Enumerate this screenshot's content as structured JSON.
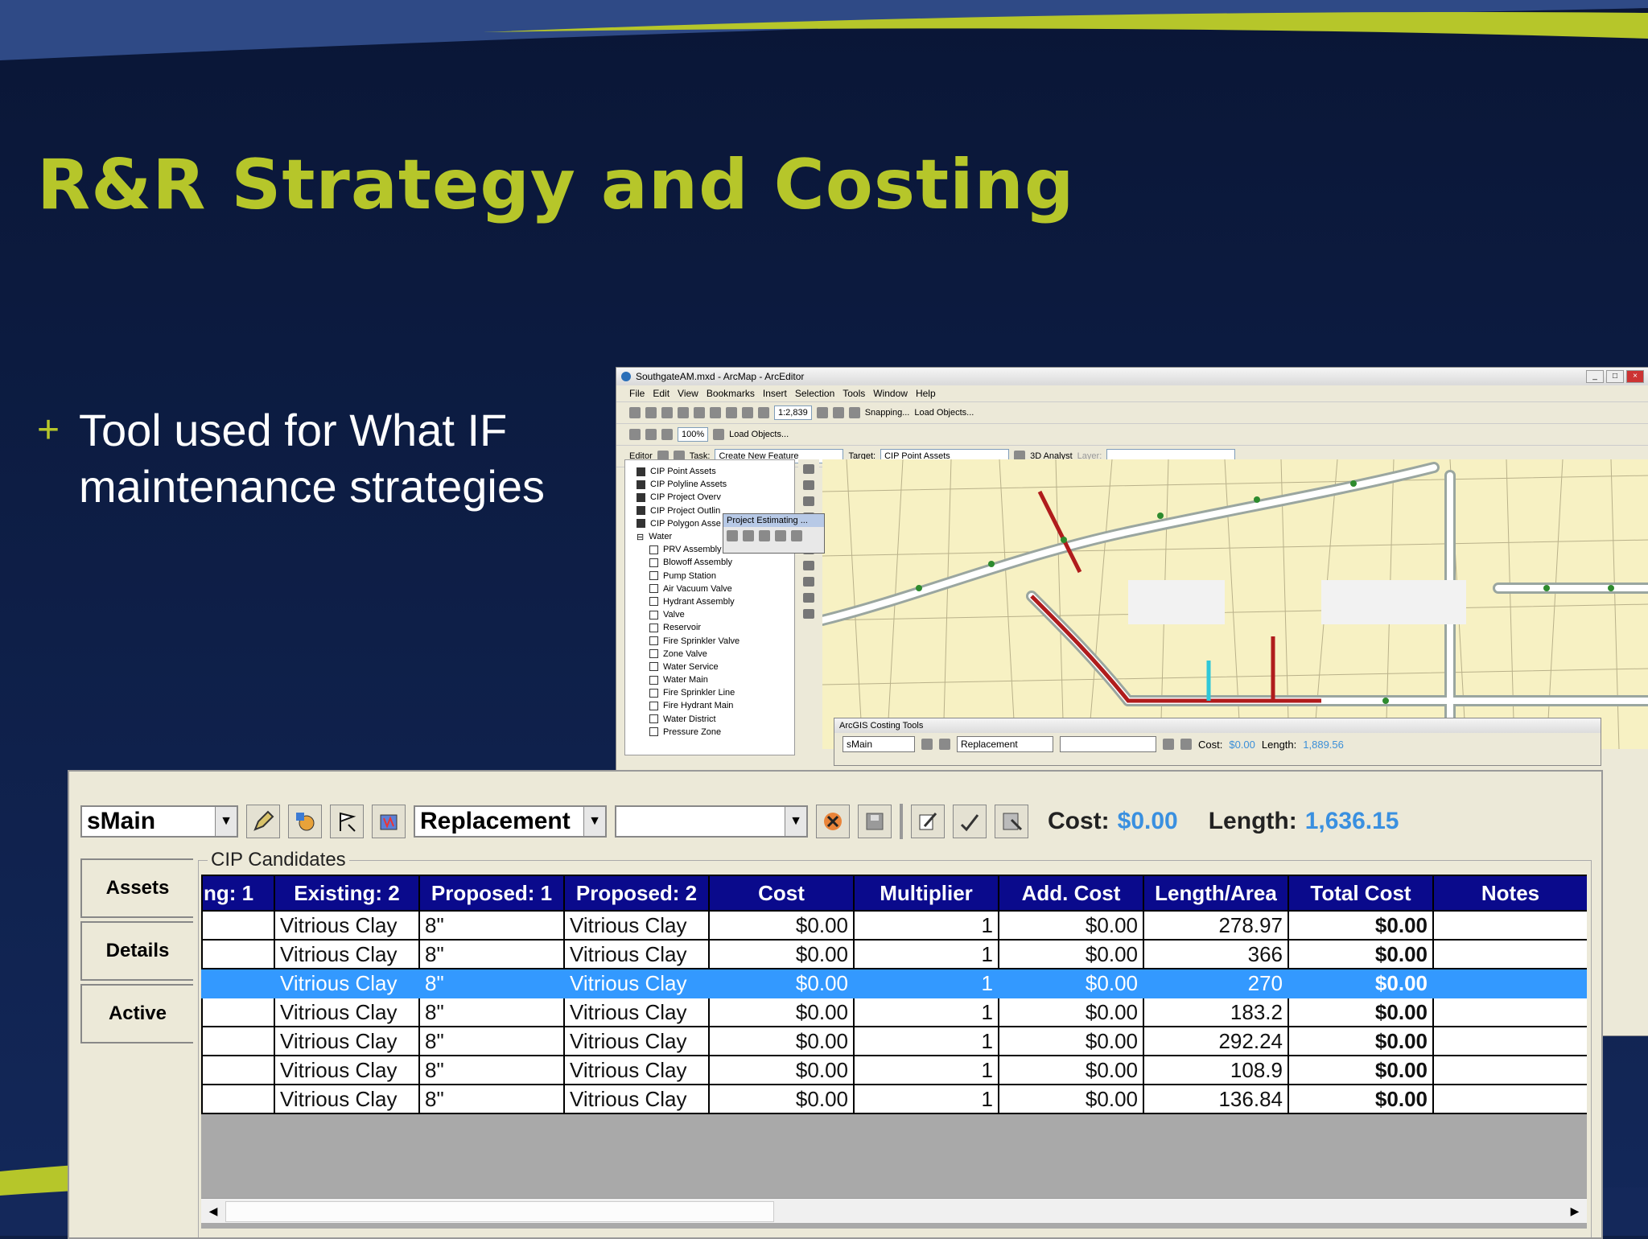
{
  "slide": {
    "title": "R&R Strategy and Costing",
    "bullet_marker": "+",
    "bullet_text": "Tool used for What IF maintenance strategies"
  },
  "arcmap": {
    "window_title": "SouthgateAM.mxd - ArcMap - ArcEditor",
    "menu": [
      "File",
      "Edit",
      "View",
      "Bookmarks",
      "Insert",
      "Selection",
      "Tools",
      "Window",
      "Help"
    ],
    "scale": "1:2,839",
    "zoom_percent": "100%",
    "snapping_label": "Snapping...",
    "load_objects_label": "Load Objects...",
    "load_objects_label2": "Load Objects...",
    "editor_label": "Editor",
    "task_label": "Task:",
    "task_value": "Create New Feature",
    "target_label": "Target:",
    "target_value": "CIP Point Assets",
    "analyst_label": "3D Analyst",
    "layer_label": "Layer:",
    "toc_items": [
      {
        "label": "CIP Point Assets",
        "checked": true
      },
      {
        "label": "CIP Polyline Assets",
        "checked": true
      },
      {
        "label": "CIP Project Overv",
        "checked": true
      },
      {
        "label": "CIP Project Outlin",
        "checked": true
      },
      {
        "label": "CIP Polygon Asse",
        "checked": true
      }
    ],
    "toc_group": "Water",
    "toc_subitems": [
      "PRV Assembly",
      "Blowoff Assembly",
      "Pump Station",
      "Air Vacuum Valve",
      "Hydrant Assembly",
      "Valve",
      "Reservoir",
      "Fire Sprinkler Valve",
      "Zone Valve",
      "Water Service",
      "Water Main",
      "Fire Sprinkler Line",
      "Fire Hydrant Main",
      "Water District",
      "Pressure Zone"
    ],
    "popup_title": "Project Estimating ...",
    "mini_costing": {
      "title": "ArcGIS Costing Tools",
      "layer": "sMain",
      "strategy": "Replacement",
      "cost_label": "Cost:",
      "cost_value": "$0.00",
      "length_label": "Length:",
      "length_value": "1,889.56"
    }
  },
  "costing_panel": {
    "layer_select": "sMain",
    "strategy_select": "Replacement",
    "blank_select": "",
    "cost_label": "Cost:",
    "cost_value": "$0.00",
    "length_label": "Length:",
    "length_value": "1,636.15",
    "group_label": "CIP Candidates",
    "side_tabs": [
      "Assets",
      "Details",
      "Active"
    ],
    "columns": [
      "ng: 1",
      "Existing: 2",
      "Proposed: 1",
      "Proposed: 2",
      "Cost",
      "Multiplier",
      "Add. Cost",
      "Length/Area",
      "Total Cost",
      "Notes"
    ],
    "rows": [
      {
        "c0": "",
        "existing2": "Vitrious Clay",
        "proposed1": "8\"",
        "proposed2": "Vitrious Clay",
        "cost": "$0.00",
        "multiplier": "1",
        "add_cost": "$0.00",
        "length": "278.97",
        "total": "$0.00",
        "notes": "",
        "selected": false
      },
      {
        "c0": "",
        "existing2": "Vitrious Clay",
        "proposed1": "8\"",
        "proposed2": "Vitrious Clay",
        "cost": "$0.00",
        "multiplier": "1",
        "add_cost": "$0.00",
        "length": "366",
        "total": "$0.00",
        "notes": "",
        "selected": false
      },
      {
        "c0": "",
        "existing2": "Vitrious Clay",
        "proposed1": "8\"",
        "proposed2": "Vitrious Clay",
        "cost": "$0.00",
        "multiplier": "1",
        "add_cost": "$0.00",
        "length": "270",
        "total": "$0.00",
        "notes": "",
        "selected": true
      },
      {
        "c0": "",
        "existing2": "Vitrious Clay",
        "proposed1": "8\"",
        "proposed2": "Vitrious Clay",
        "cost": "$0.00",
        "multiplier": "1",
        "add_cost": "$0.00",
        "length": "183.2",
        "total": "$0.00",
        "notes": "",
        "selected": false
      },
      {
        "c0": "",
        "existing2": "Vitrious Clay",
        "proposed1": "8\"",
        "proposed2": "Vitrious Clay",
        "cost": "$0.00",
        "multiplier": "1",
        "add_cost": "$0.00",
        "length": "292.24",
        "total": "$0.00",
        "notes": "",
        "selected": false
      },
      {
        "c0": "",
        "existing2": "Vitrious Clay",
        "proposed1": "8\"",
        "proposed2": "Vitrious Clay",
        "cost": "$0.00",
        "multiplier": "1",
        "add_cost": "$0.00",
        "length": "108.9",
        "total": "$0.00",
        "notes": "",
        "selected": false
      },
      {
        "c0": "",
        "existing2": "Vitrious Clay",
        "proposed1": "8\"",
        "proposed2": "Vitrious Clay",
        "cost": "$0.00",
        "multiplier": "1",
        "add_cost": "$0.00",
        "length": "136.84",
        "total": "$0.00",
        "notes": "",
        "selected": false
      }
    ]
  },
  "colors": {
    "title_green": "#b6c62a",
    "slide_navy": "#0d1d44",
    "grid_header": "#0a0a8c",
    "selection_blue": "#3399ff",
    "value_blue": "#3a90e0",
    "pipe_red": "#b01c1c"
  }
}
